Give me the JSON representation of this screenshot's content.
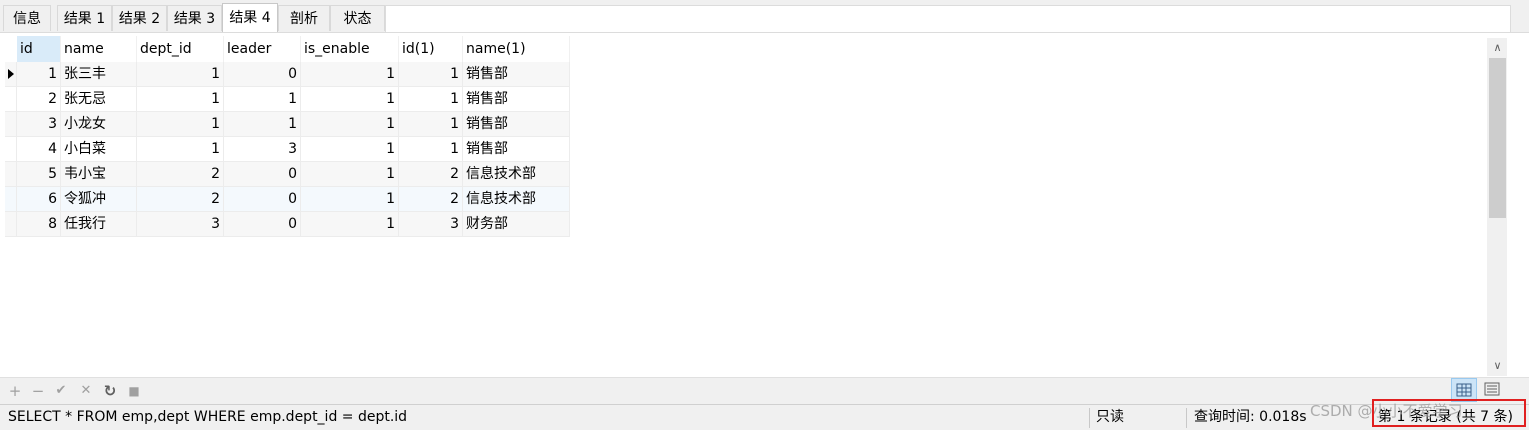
{
  "tabs": [
    "信息",
    "结果 1",
    "结果 2",
    "结果 3",
    "结果 4",
    "剖析",
    "状态"
  ],
  "active_tab": "结果 4",
  "columns": [
    "id",
    "name",
    "dept_id",
    "leader",
    "is_enable",
    "id(1)",
    "name(1)"
  ],
  "rows": [
    {
      "id": "1",
      "name": "张三丰",
      "dept_id": "1",
      "leader": "0",
      "is_enable": "1",
      "id1": "1",
      "name1": "销售部"
    },
    {
      "id": "2",
      "name": "张无忌",
      "dept_id": "1",
      "leader": "1",
      "is_enable": "1",
      "id1": "1",
      "name1": "销售部"
    },
    {
      "id": "3",
      "name": "小龙女",
      "dept_id": "1",
      "leader": "1",
      "is_enable": "1",
      "id1": "1",
      "name1": "销售部"
    },
    {
      "id": "4",
      "name": "小白菜",
      "dept_id": "1",
      "leader": "3",
      "is_enable": "1",
      "id1": "1",
      "name1": "销售部"
    },
    {
      "id": "5",
      "name": "韦小宝",
      "dept_id": "2",
      "leader": "0",
      "is_enable": "1",
      "id1": "2",
      "name1": "信息技术部"
    },
    {
      "id": "6",
      "name": "令狐冲",
      "dept_id": "2",
      "leader": "0",
      "is_enable": "1",
      "id1": "2",
      "name1": "信息技术部"
    },
    {
      "id": "8",
      "name": "任我行",
      "dept_id": "3",
      "leader": "0",
      "is_enable": "1",
      "id1": "3",
      "name1": "财务部"
    }
  ],
  "toolbar_icons": [
    "plus-icon",
    "minus-icon",
    "check-icon",
    "cross-icon",
    "refresh-icon",
    "stop-icon"
  ],
  "toolbar_glyphs": {
    "add": "+",
    "remove": "−",
    "apply": "✔",
    "cancel": "✕",
    "refresh": "↻",
    "stop": "■"
  },
  "status": {
    "sql": "SELECT * FROM emp,dept WHERE emp.dept_id = dept.id",
    "readonly": "只读",
    "query_time": "查询时间: 0.018s",
    "record": "第 1 条记录 (共 7 条)"
  },
  "watermark": "CSDN @小小不爱学习",
  "colors": {
    "header_selected": "#d9ebf9",
    "highlight_box": "#e02020"
  }
}
